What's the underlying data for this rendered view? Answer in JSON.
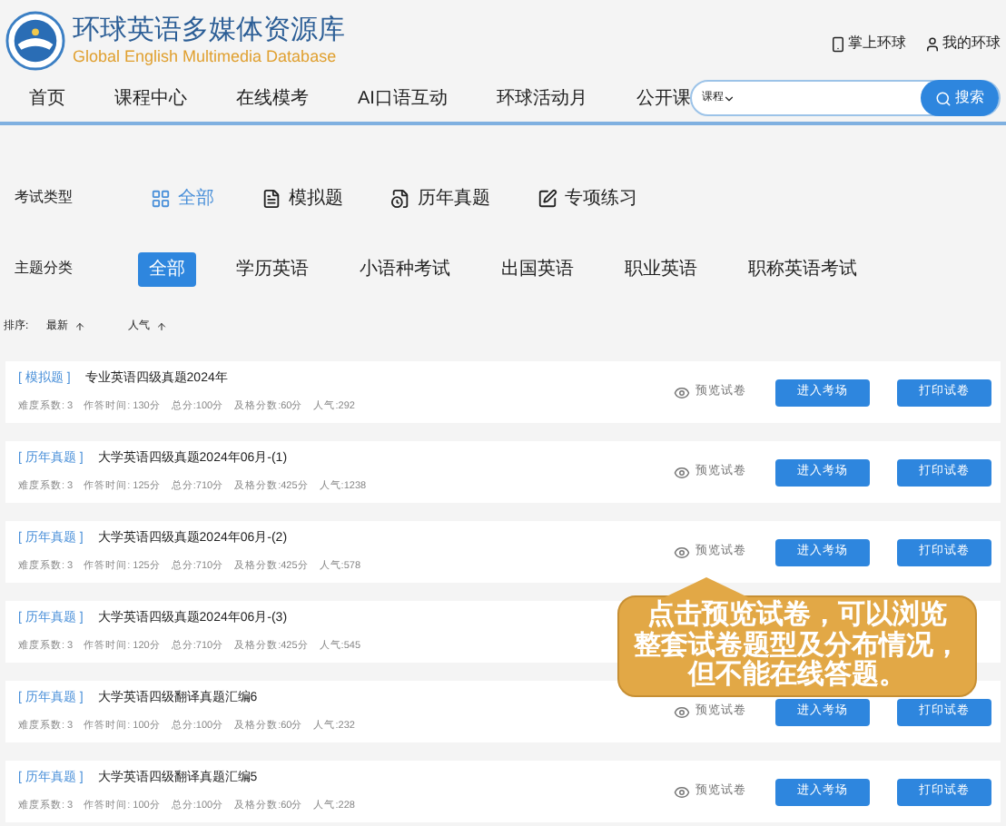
{
  "header": {
    "title": "环球英语多媒体资源库",
    "subtitle": "Global English Multimedia Database",
    "links": [
      "掌上环球",
      "我的环球"
    ]
  },
  "nav": {
    "items": [
      "首页",
      "课程中心",
      "在线模考",
      "AI口语互动",
      "环球活动月",
      "公开课"
    ],
    "search": {
      "scope": "课程",
      "button": "搜索"
    }
  },
  "exam_type": {
    "label": "考试类型",
    "options": [
      {
        "label": "全部",
        "selected": true,
        "kind": "grid"
      },
      {
        "label": "模拟题",
        "selected": false,
        "kind": "doc"
      },
      {
        "label": "历年真题",
        "selected": false,
        "kind": "history"
      },
      {
        "label": "专项练习",
        "selected": false,
        "kind": "edit"
      }
    ]
  },
  "topic": {
    "label": "主题分类",
    "options": [
      {
        "label": "全部",
        "selected": true
      },
      {
        "label": "学历英语",
        "selected": false
      },
      {
        "label": "小语种考试",
        "selected": false
      },
      {
        "label": "出国英语",
        "selected": false
      },
      {
        "label": "职业英语",
        "selected": false
      },
      {
        "label": "职称英语考试",
        "selected": false
      }
    ]
  },
  "sort": {
    "label": "排序:",
    "options": [
      "最新",
      "人气"
    ]
  },
  "papers": [
    {
      "tag": "[ 模拟题 ]",
      "title": "专业英语四级真题2024年",
      "meta": [
        "难度系数: 3",
        "作答时间: 130分",
        "总分:100分",
        "及格分数:60分",
        "人气:292"
      ],
      "preview": "预览试卷",
      "enter": "进入考场",
      "print": "打印试卷"
    },
    {
      "tag": "[ 历年真题 ]",
      "title": "大学英语四级真题2024年06月-(1)",
      "meta": [
        "难度系数: 3",
        "作答时间: 125分",
        "总分:710分",
        "及格分数:425分",
        "人气:1238"
      ],
      "preview": "预览试卷",
      "enter": "进入考场",
      "print": "打印试卷"
    },
    {
      "tag": "[ 历年真题 ]",
      "title": "大学英语四级真题2024年06月-(2)",
      "meta": [
        "难度系数: 3",
        "作答时间: 125分",
        "总分:710分",
        "及格分数:425分",
        "人气:578"
      ],
      "preview": "预览试卷",
      "enter": "进入考场",
      "print": "打印试卷"
    },
    {
      "tag": "[ 历年真题 ]",
      "title": "大学英语四级真题2024年06月-(3)",
      "meta": [
        "难度系数: 3",
        "作答时间: 120分",
        "总分:710分",
        "及格分数:425分",
        "人气:545"
      ]
    },
    {
      "tag": "[ 历年真题 ]",
      "title": "大学英语四级翻译真题汇编6",
      "meta": [
        "难度系数: 3",
        "作答时间: 100分",
        "总分:100分",
        "及格分数:60分",
        "人气:232"
      ],
      "preview": "预览试卷",
      "enter": "进入考场",
      "print": "打印试卷"
    },
    {
      "tag": "[ 历年真题 ]",
      "title": "大学英语四级翻译真题汇编5",
      "meta": [
        "难度系数: 3",
        "作答时间: 100分",
        "总分:100分",
        "及格分数:60分",
        "人气:228"
      ],
      "preview": "预览试卷",
      "enter": "进入考场",
      "print": "打印试卷"
    }
  ],
  "callout": {
    "lines": [
      "点击预览试卷，可以浏览",
      "整套试卷题型及分布情况，",
      "但不能在线答题。"
    ]
  }
}
